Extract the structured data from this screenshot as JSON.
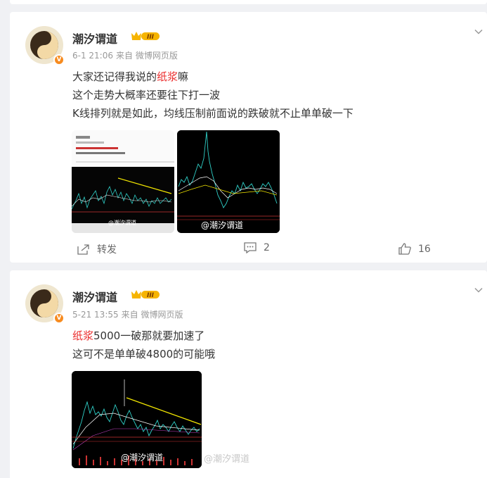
{
  "posts": [
    {
      "user": "潮汐谓道",
      "vip_label": "III",
      "verified_badge": "V",
      "time": "6-1 21:06",
      "source": "来自 微博网页版",
      "lines": [
        {
          "pre": "大家还记得我说的",
          "hl": "纸浆",
          "post": "嘛"
        },
        {
          "pre": "这个走势大概率还要往下打一波",
          "hl": "",
          "post": ""
        },
        {
          "pre": "K线排列就是如此，均线压制前面说的跌破就不止单单破一下",
          "hl": "",
          "post": ""
        }
      ],
      "image1_watermark": "@潮汐谓道",
      "image2_watermark": "@潮汐谓道",
      "repost_label": "转发",
      "comment_count": "2",
      "like_count": "16"
    },
    {
      "user": "潮汐谓道",
      "vip_label": "III",
      "verified_badge": "V",
      "time": "5-21 13:55",
      "source": "来自 微博网页版",
      "lines": [
        {
          "pre": "",
          "hl": "纸浆",
          "post": "5000一破那就要加速了"
        },
        {
          "pre": "这可不是单单破4800的可能哦",
          "hl": "",
          "post": ""
        }
      ],
      "image_watermark": "@潮汐谓道",
      "image_watermark_outside": "@潮汐谓道"
    }
  ],
  "colors": {
    "highlight": "#eb2c2c",
    "vip_gold": "#f6b400",
    "badge_orange": "#f78b1f",
    "chart_bg": "#000000",
    "chart_line": "#f2e600"
  }
}
